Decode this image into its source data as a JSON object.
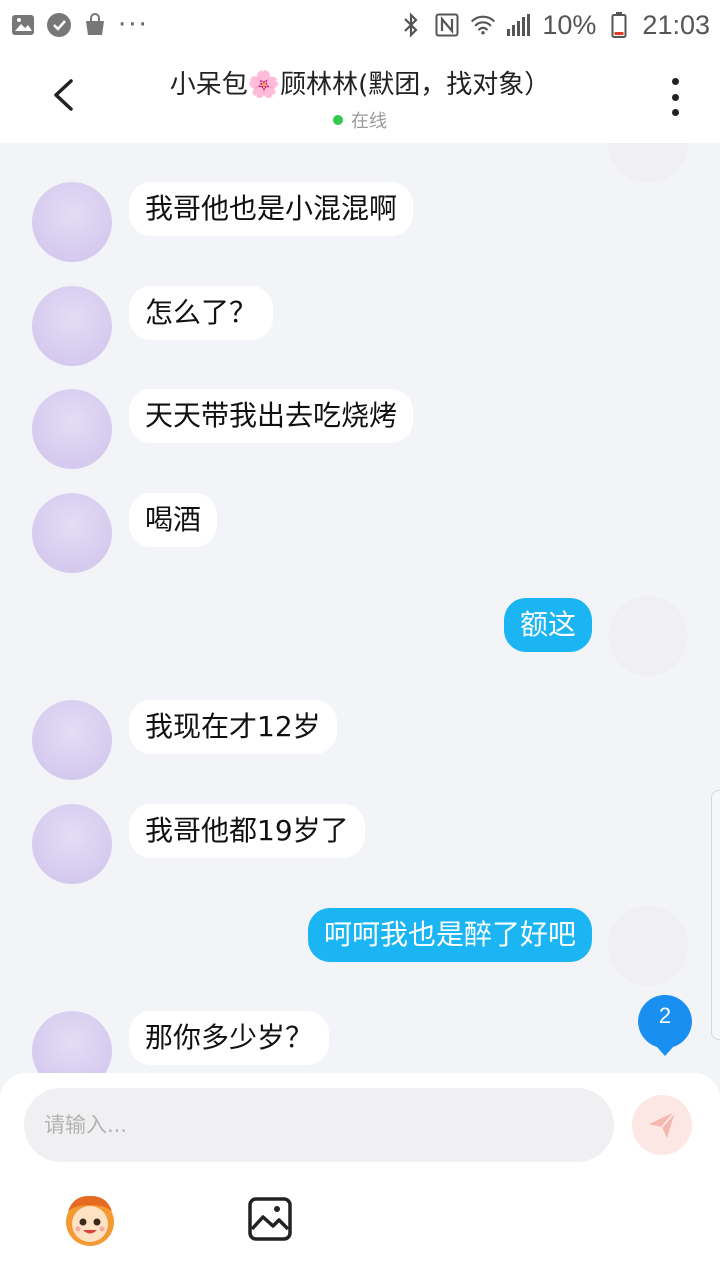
{
  "status_bar": {
    "battery": "10%",
    "time": "21:03",
    "more": "···"
  },
  "header": {
    "title": "小呆包🌸顾林林(默团，找对象）",
    "status": "在线",
    "status_color": "#2fca4b"
  },
  "messages": [
    {
      "side": "in",
      "text": "我哥他也是小混混啊"
    },
    {
      "side": "in",
      "text": "怎么了？"
    },
    {
      "side": "in",
      "text": "天天带我出去吃烧烤"
    },
    {
      "side": "in",
      "text": "喝酒"
    },
    {
      "side": "out",
      "text": "额这"
    },
    {
      "side": "in",
      "text": "我现在才12岁"
    },
    {
      "side": "in",
      "text": "我哥他都19岁了"
    },
    {
      "side": "out",
      "text": "呵呵我也是醉了好吧"
    },
    {
      "side": "in",
      "text": "那你多少岁？"
    }
  ],
  "unread_badge": "2",
  "composer": {
    "placeholder": "请输入...",
    "value": ""
  },
  "colors": {
    "outgoing_bubble": "#1ab5f2",
    "incoming_bubble": "#ffffff",
    "chat_background": "#f3f4f8",
    "send_button": "#fde7e5"
  },
  "icons": [
    "gallery-icon",
    "settings-sync-icon",
    "shopping-bag-icon",
    "bluetooth-icon",
    "nfc-icon",
    "wifi-icon",
    "signal-icon",
    "battery-icon",
    "back-icon",
    "more-icon",
    "send-icon",
    "emoji-icon",
    "image-icon"
  ]
}
